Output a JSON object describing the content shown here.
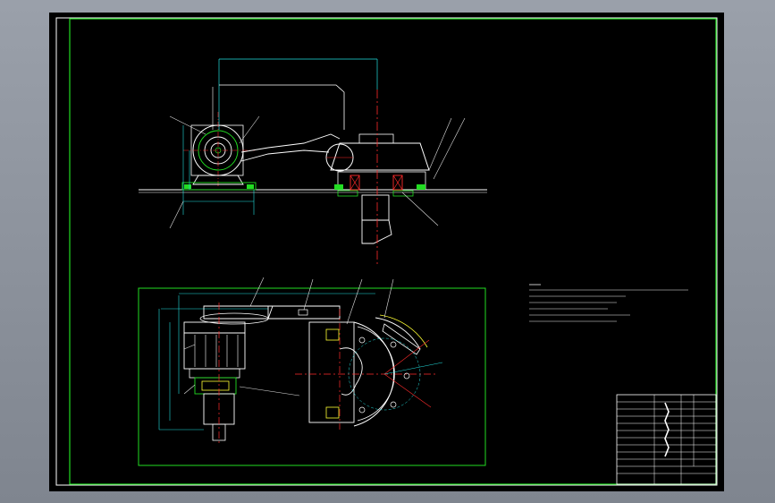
{
  "app": {
    "title": "",
    "viewport_background": "#000000",
    "chrome_background": "#8e949e"
  },
  "colors": {
    "border": "#22dd22",
    "geometry": "#ffffff",
    "center": "#ff2b2b",
    "dimension": "#22e0e0",
    "part": "#22dd22",
    "hatch": "#ffff33",
    "leader": "#e0e0e0"
  },
  "drawing": {
    "elements": [
      "top-view",
      "front-view",
      "technical-notes",
      "title-block"
    ]
  },
  "title_block": {
    "rows": 13
  }
}
